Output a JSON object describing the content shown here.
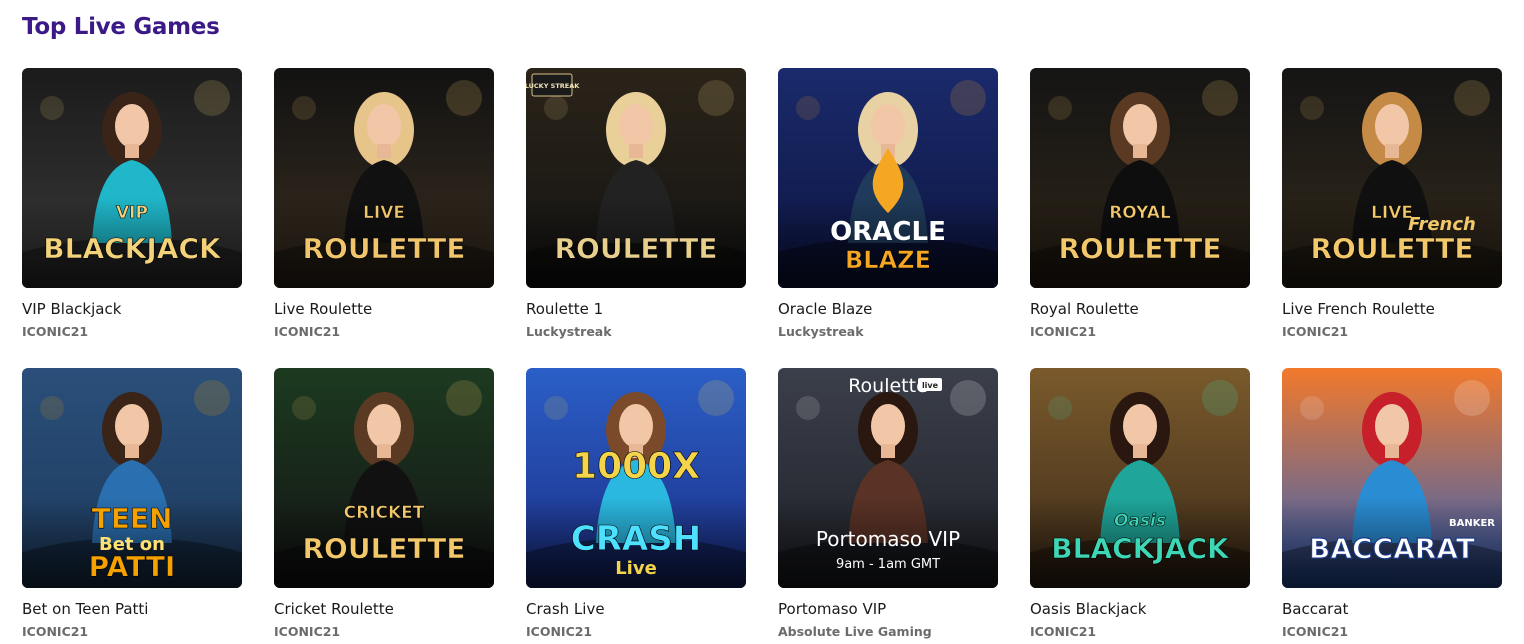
{
  "section": {
    "title": "Top Live Games"
  },
  "games": [
    {
      "name": "VIP Blackjack",
      "provider": "ICONIC21",
      "art_line1": "VIP",
      "art_line2": "BLACKJACK",
      "bg1": "#1b1b1b",
      "bg2": "#3a3a3a",
      "accent": "#f3d27a",
      "dress": "#1fb7c9"
    },
    {
      "name": "Live Roulette",
      "provider": "ICONIC21",
      "art_line1": "LIVE",
      "art_line2": "ROULETTE",
      "bg1": "#121212",
      "bg2": "#3a2e20",
      "accent": "#f0c56c",
      "dress": "#111111"
    },
    {
      "name": "Roulette 1",
      "provider": "Luckystreak",
      "art_line1": "",
      "art_line2": "ROULETTE",
      "badge": "LUCKY STREAK",
      "bg1": "#2a2318",
      "bg2": "#141414",
      "accent": "#e8cf8c",
      "dress": "#222222"
    },
    {
      "name": "Oracle Blaze",
      "provider": "Luckystreak",
      "art_line1": "ORACLE",
      "art_line2": "BLAZE",
      "bg1": "#1a2a6b",
      "bg2": "#0d1440",
      "accent": "#f5a623",
      "dress": "#1f3a5a"
    },
    {
      "name": "Royal Roulette",
      "provider": "ICONIC21",
      "art_line1": "ROYAL",
      "art_line2": "ROULETTE",
      "bg1": "#151515",
      "bg2": "#2e2416",
      "accent": "#f2c86a",
      "dress": "#0e0e0e"
    },
    {
      "name": "Live French Roulette",
      "provider": "ICONIC21",
      "art_line1": "LIVE",
      "art_line2": "ROULETTE",
      "art_extra": "French",
      "bg1": "#151515",
      "bg2": "#33291a",
      "accent": "#f2c86a",
      "dress": "#101010"
    },
    {
      "name": "Bet on Teen Patti",
      "provider": "ICONIC21",
      "art_line1": "TEEN",
      "art_line2": "PATTI",
      "art_extra": "Bet on",
      "bg1": "#2a4f7a",
      "bg2": "#1d3a5c",
      "accent": "#f5a200",
      "dress": "#2a6fb0"
    },
    {
      "name": "Cricket Roulette",
      "provider": "ICONIC21",
      "art_line1": "CRICKET",
      "art_line2": "ROULETTE",
      "bg1": "#1c3a20",
      "bg2": "#141414",
      "accent": "#f2c86a",
      "dress": "#111111"
    },
    {
      "name": "Crash Live",
      "provider": "ICONIC21",
      "art_line1": "1000X",
      "art_line2": "CRASH",
      "art_extra": "Live",
      "bg1": "#2b5fc7",
      "bg2": "#1b2e86",
      "accent": "#f4d44a",
      "dress": "#2bb8e0"
    },
    {
      "name": "Portomaso VIP",
      "provider": "Absolute Live Gaming",
      "art_line1": "Roulette",
      "art_line2": "Portomaso VIP",
      "art_extra": "9am - 1am GMT",
      "badge": "live",
      "bg1": "#3b3f4a",
      "bg2": "#1e2027",
      "accent": "#ffffff",
      "dress": "#5a3226"
    },
    {
      "name": "Oasis Blackjack",
      "provider": "ICONIC21",
      "art_line1": "Oasis",
      "art_line2": "BLACKJACK",
      "bg1": "#7a5a2c",
      "bg2": "#3c2a18",
      "accent": "#3ed6b4",
      "dress": "#1fa59a"
    },
    {
      "name": "Baccarat",
      "provider": "ICONIC21",
      "art_line1": "BANKER",
      "art_line2": "BACCARAT",
      "bg1": "#f2792b",
      "bg2": "#2a60c2",
      "accent": "#ffffff",
      "dress": "#2a8cd2"
    }
  ]
}
